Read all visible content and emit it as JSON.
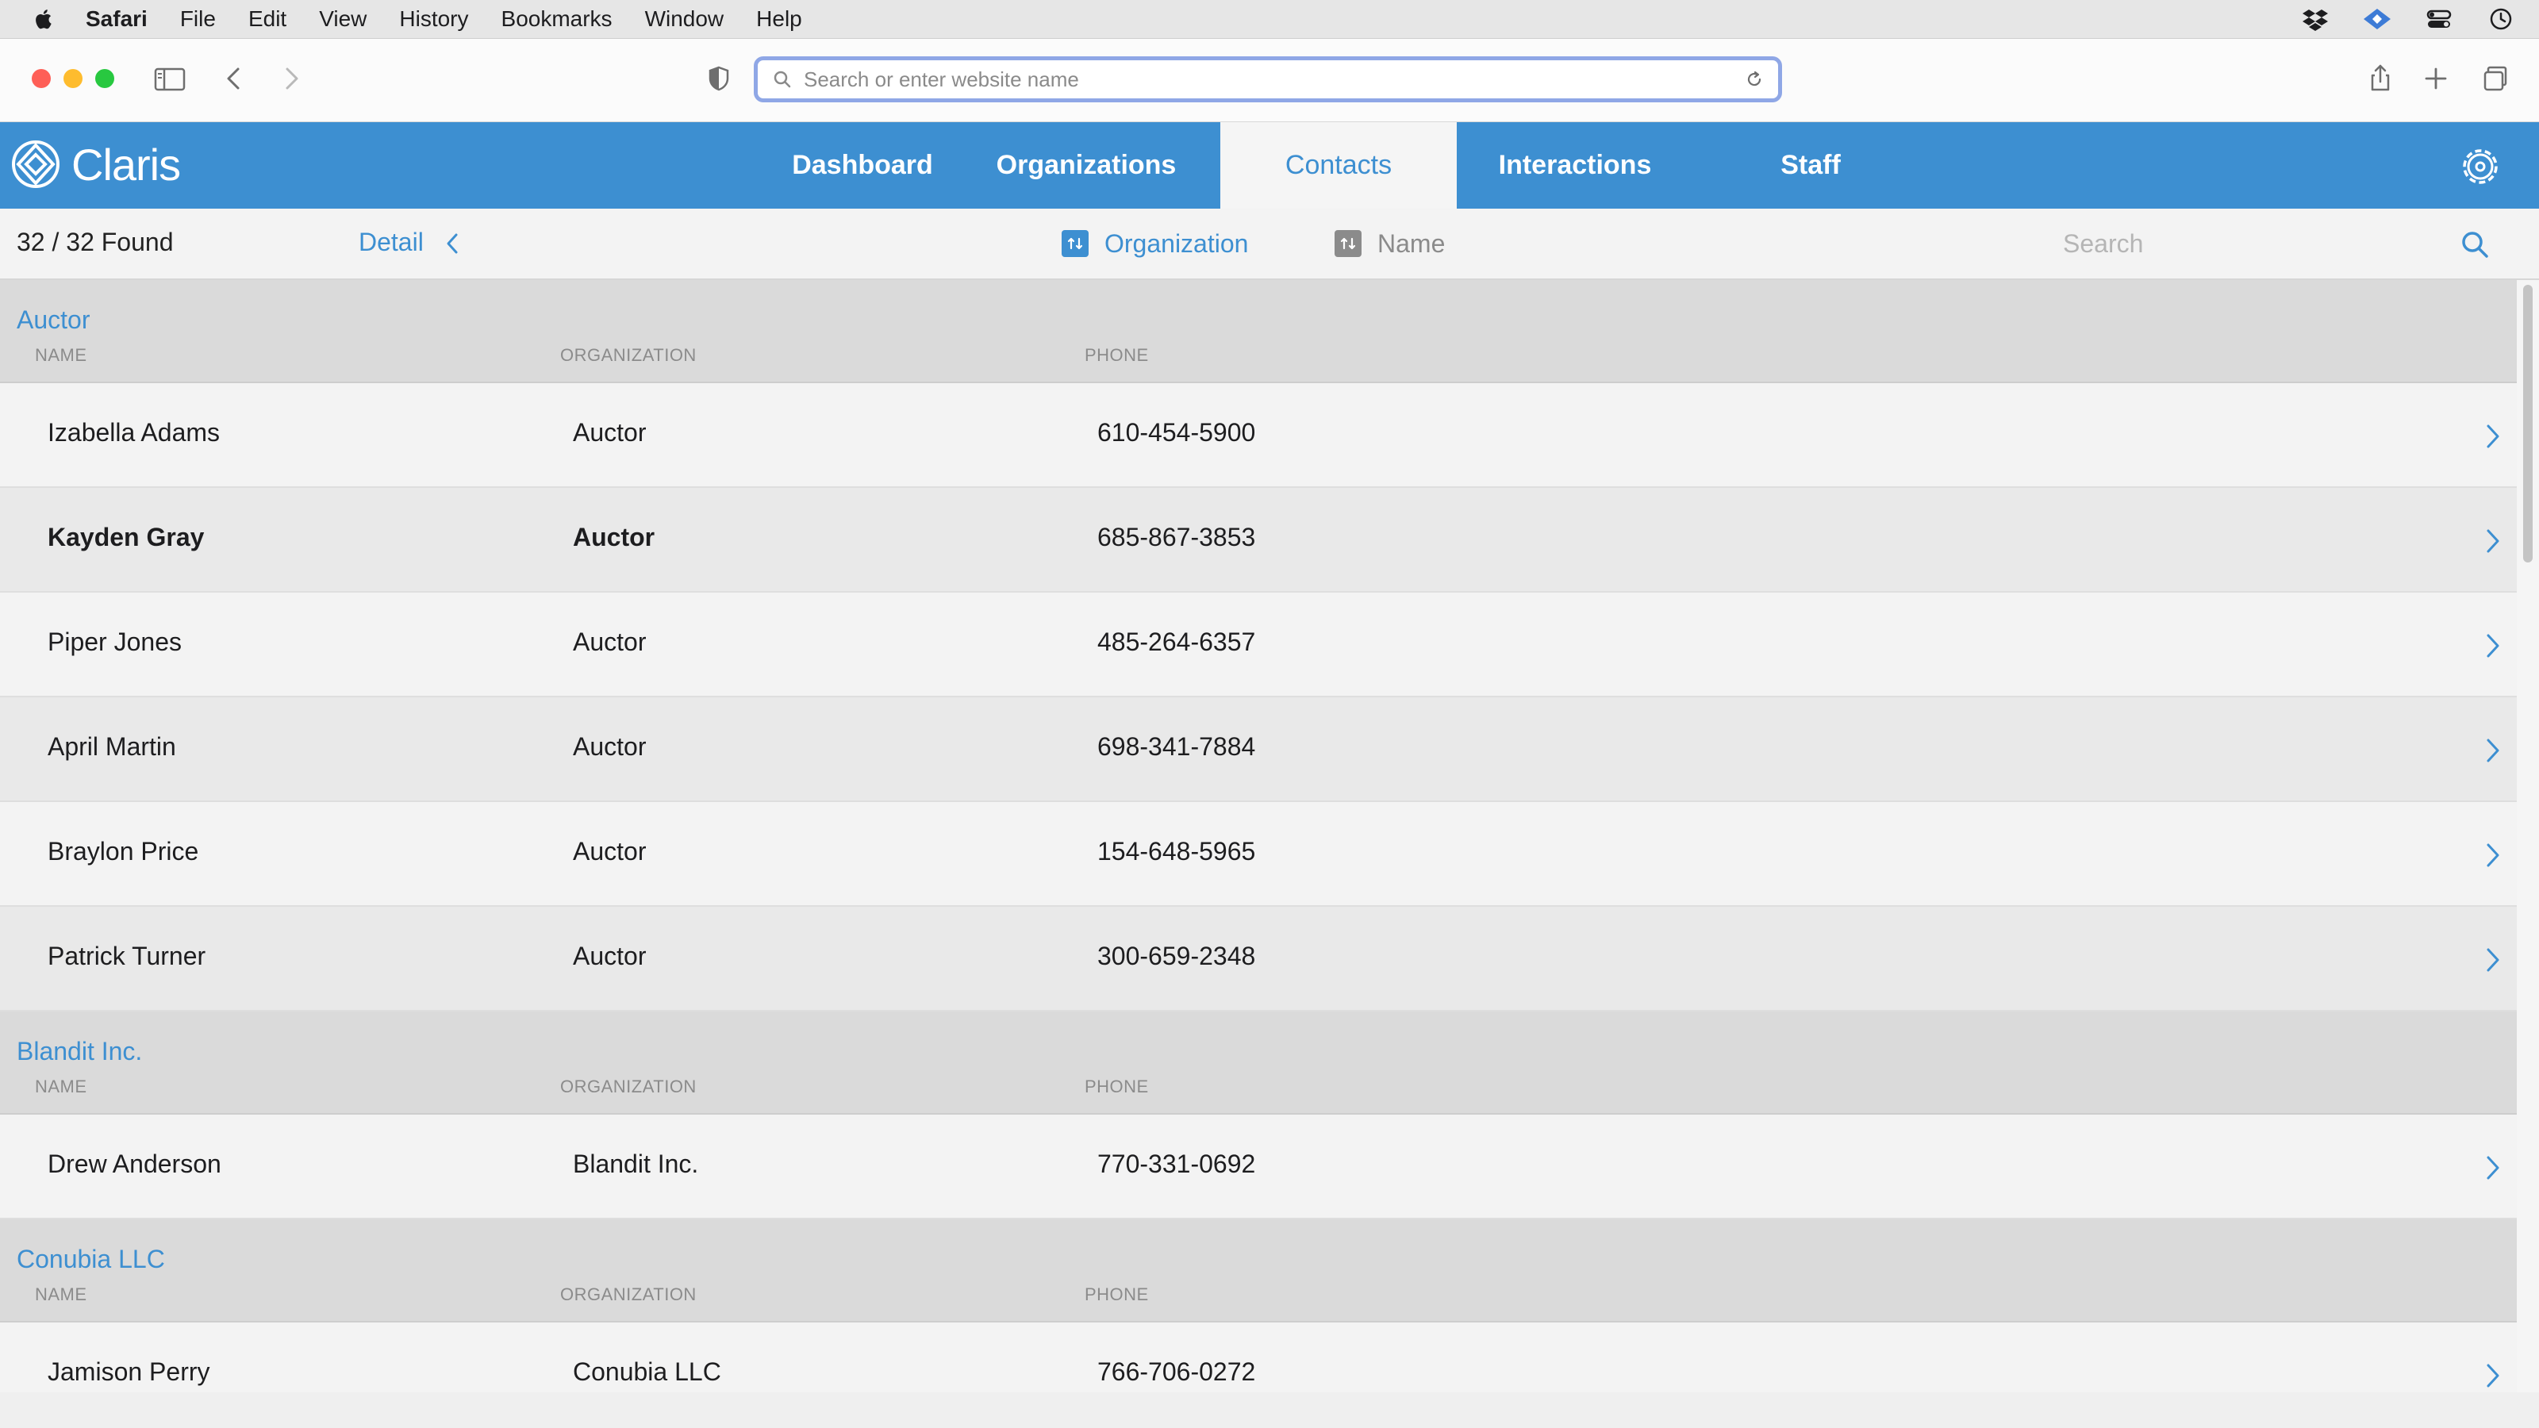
{
  "menubar": {
    "app": "Safari",
    "items": [
      "File",
      "Edit",
      "View",
      "History",
      "Bookmarks",
      "Window",
      "Help"
    ]
  },
  "toolbar": {
    "address_placeholder": "Search or enter website name"
  },
  "app": {
    "logo_text": "Claris",
    "brand_color": "#3d8fd1",
    "tabs": [
      {
        "label": "Dashboard",
        "active": false
      },
      {
        "label": "Organizations",
        "active": false
      },
      {
        "label": "Contacts",
        "active": true
      },
      {
        "label": "Interactions",
        "active": false
      },
      {
        "label": "Staff",
        "active": false
      }
    ]
  },
  "subbar": {
    "found": "32 / 32 Found",
    "detail": "Detail",
    "sort_org": "Organization",
    "sort_name": "Name",
    "search_placeholder": "Search"
  },
  "columns": {
    "name": "NAME",
    "organization": "ORGANIZATION",
    "phone": "PHONE"
  },
  "groups": [
    {
      "title": "Auctor",
      "rows": [
        {
          "name": "Izabella Adams",
          "organization": "Auctor",
          "phone": "610-454-5900",
          "bold": false
        },
        {
          "name": "Kayden Gray",
          "organization": "Auctor",
          "phone": "685-867-3853",
          "bold": true
        },
        {
          "name": "Piper Jones",
          "organization": "Auctor",
          "phone": "485-264-6357",
          "bold": false
        },
        {
          "name": "April Martin",
          "organization": "Auctor",
          "phone": "698-341-7884",
          "bold": false
        },
        {
          "name": "Braylon Price",
          "organization": "Auctor",
          "phone": "154-648-5965",
          "bold": false
        },
        {
          "name": "Patrick Turner",
          "organization": "Auctor",
          "phone": "300-659-2348",
          "bold": false
        }
      ]
    },
    {
      "title": "Blandit Inc.",
      "rows": [
        {
          "name": "Drew Anderson",
          "organization": "Blandit Inc.",
          "phone": "770-331-0692",
          "bold": false
        }
      ]
    },
    {
      "title": "Conubia LLC",
      "rows": [
        {
          "name": "Jamison Perry",
          "organization": "Conubia LLC",
          "phone": "766-706-0272",
          "bold": false
        }
      ]
    }
  ]
}
